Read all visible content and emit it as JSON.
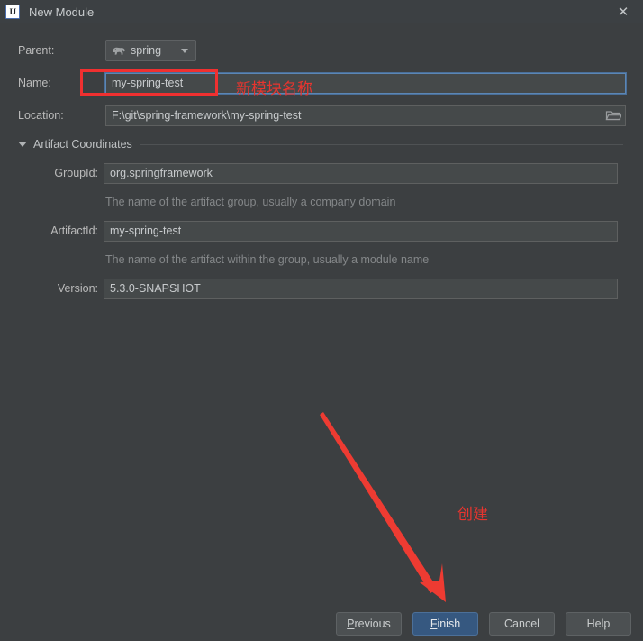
{
  "window": {
    "title": "New Module",
    "app_icon": "intellij-idea-icon",
    "icon_text": "IJ",
    "close_icon": "close-icon"
  },
  "colors": {
    "dialog_bg": "#3c3f41",
    "titlebar_bg": "#3c4043",
    "field_bg": "#45494a",
    "field_border": "#5e6060",
    "focus_border": "#5b86b5",
    "primary_button": "#365880",
    "annotation_red": "#e8352f",
    "annotation_box_red": "#f03030",
    "text": "#bbbbbb",
    "hint_text": "#848789"
  },
  "form": {
    "parent": {
      "label": "Parent:",
      "value": "spring",
      "icon": "gradle-elephant-icon",
      "dropdown_icon": "chevron-down-icon"
    },
    "name": {
      "label": "Name:",
      "value": "my-spring-test",
      "focused": true
    },
    "location": {
      "label": "Location:",
      "value": "F:\\git\\spring-framework\\my-spring-test",
      "browse_icon": "folder-icon"
    }
  },
  "artifact_coordinates": {
    "section_label": "Artifact Coordinates",
    "expanded": true,
    "collapse_icon": "triangle-down-icon",
    "fields": [
      {
        "label": "GroupId:",
        "value": "org.springframework",
        "hint": "The name of the artifact group, usually a company domain"
      },
      {
        "label": "ArtifactId:",
        "value": "my-spring-test",
        "hint": "The name of the artifact within the group, usually a module name"
      },
      {
        "label": "Version:",
        "value": "5.3.0-SNAPSHOT",
        "hint": ""
      }
    ]
  },
  "buttons": {
    "previous": {
      "label": "Previous",
      "mnemonic": "P",
      "primary": false
    },
    "finish": {
      "label": "Finish",
      "mnemonic": "F",
      "primary": true
    },
    "cancel": {
      "label": "Cancel",
      "mnemonic": "",
      "primary": false
    },
    "help": {
      "label": "Help",
      "mnemonic": "",
      "primary": false
    }
  },
  "annotations": {
    "name_label": "新模块名称",
    "create_label": "创建",
    "box_target": "name-input",
    "arrow_target": "finish-button"
  }
}
